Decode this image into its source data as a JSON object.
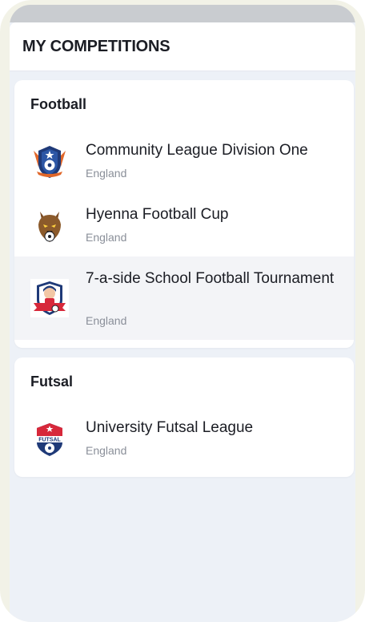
{
  "header": {
    "title": "MY COMPETITIONS"
  },
  "sections": [
    {
      "title": "Football",
      "items": [
        {
          "name": "Community League Division One",
          "country": "England",
          "logo": "eagle-shield-badge-icon"
        },
        {
          "name": "Hyenna Football Cup",
          "country": "England",
          "logo": "hyena-badge-icon"
        },
        {
          "name": "7-a-side School Football Tournament",
          "country": "England",
          "logo": "school-kid-badge-icon"
        }
      ]
    },
    {
      "title": "Futsal",
      "items": [
        {
          "name": "University Futsal League",
          "country": "England",
          "logo": "futsal-shield-badge-icon"
        }
      ]
    }
  ],
  "colors": {
    "accent_red": "#d7283a",
    "navy": "#1f3a78",
    "background": "#edf1f7"
  }
}
